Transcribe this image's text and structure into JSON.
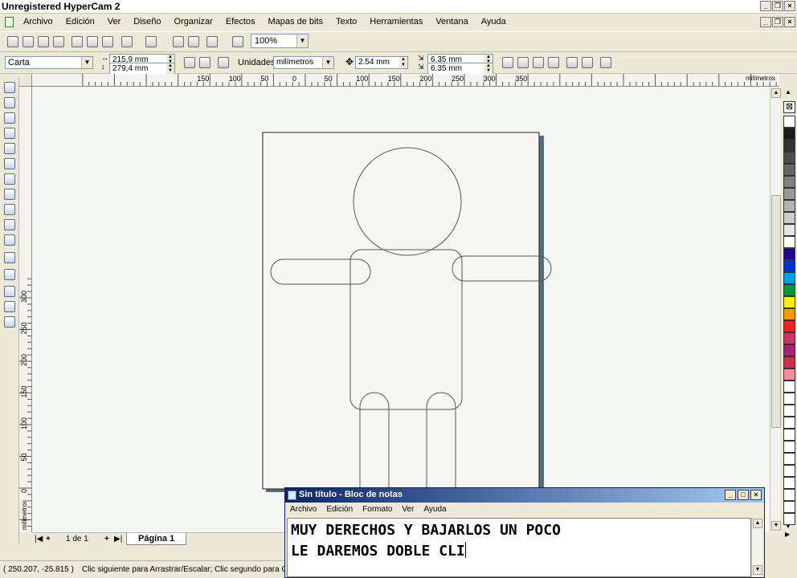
{
  "window": {
    "title": "Unregistered HyperCam 2"
  },
  "menubar": {
    "items": [
      "Archivo",
      "Edición",
      "Ver",
      "Diseño",
      "Organizar",
      "Efectos",
      "Mapas de bits",
      "Texto",
      "Herramientas",
      "Ventana",
      "Ayuda"
    ]
  },
  "toolbar": {
    "zoom": "100%"
  },
  "propbar": {
    "paper_type": "Carta",
    "width": "215,9 mm",
    "height": "279,4 mm",
    "units_label": "Unidades:",
    "units_value": "milímetros",
    "nudge": "2.54 mm",
    "dup_x": "6.35 mm",
    "dup_y": "6.35 mm"
  },
  "rulers": {
    "h_labels": [
      "150",
      "100",
      "50",
      "0",
      "50",
      "100",
      "150",
      "200",
      "250",
      "300",
      "350"
    ],
    "h_units": "milímetros",
    "v_labels": [
      "300",
      "250",
      "200",
      "150",
      "100",
      "50",
      "0"
    ],
    "v_units": "milímetros"
  },
  "pagebar": {
    "counter": "1 de 1",
    "tab": "Página 1"
  },
  "status": {
    "coords": "( 250.207, -25.815 )",
    "message": "Clic siguiente para Arrastrar/Escalar; Clic segundo para Girar"
  },
  "palette": {
    "colors": [
      "#ffffff",
      "#1a1a1a",
      "#333333",
      "#4d4d4d",
      "#666666",
      "#808080",
      "#999999",
      "#b3b3b3",
      "#cccccc",
      "#e6e6e6",
      "#ffffff",
      "#1a0a8c",
      "#0033cc",
      "#00a0e0",
      "#009933",
      "#ffee00",
      "#ff9900",
      "#ee2222",
      "#cc3366",
      "#a6217a",
      "#c8324b",
      "#f58ca0",
      "#ffffff",
      "#ffffff",
      "#ffffff",
      "#ffffff",
      "#ffffff",
      "#ffffff",
      "#ffffff",
      "#ffffff",
      "#ffffff",
      "#ffffff",
      "#ffffff",
      "#ffffff"
    ]
  },
  "notepad": {
    "title": "Sin título - Bloc de notas",
    "menu": [
      "Archivo",
      "Edición",
      "Formato",
      "Ver",
      "Ayuda"
    ],
    "lines": [
      "MUY DERECHOS Y BAJARLOS UN POCO",
      "LE DAREMOS DOBLE CLI"
    ]
  }
}
